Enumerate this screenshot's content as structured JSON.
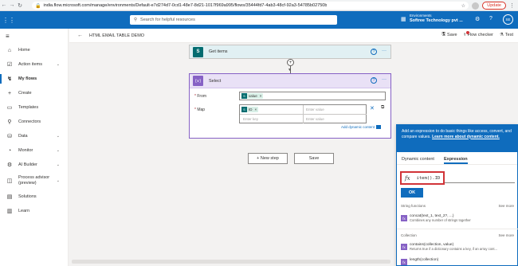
{
  "browser": {
    "url": "india.flow.microsoft.com/manage/environments/Default-e7d274d7-0cd1-48e7-8d21-1017f969a995/flows/35444fd7-4ab3-48cf-92a3-54785b02750b",
    "update_label": "Update"
  },
  "header": {
    "search_placeholder": "Search for helpful resources",
    "env_label": "Environments",
    "env_name": "Softree Technology pvt ...",
    "avatar_initials": "SE"
  },
  "sidebar": {
    "items": [
      {
        "label": "Home",
        "icon": "home-icon",
        "glyph": "⌂"
      },
      {
        "label": "Action items",
        "icon": "checklist-icon",
        "glyph": "☑",
        "chevron": true
      },
      {
        "label": "My flows",
        "icon": "flow-icon",
        "glyph": "↯",
        "active": true
      },
      {
        "label": "Create",
        "icon": "plus-icon",
        "glyph": "+"
      },
      {
        "label": "Templates",
        "icon": "template-icon",
        "glyph": "▭"
      },
      {
        "label": "Connectors",
        "icon": "connector-icon",
        "glyph": "⚲"
      },
      {
        "label": "Data",
        "icon": "database-icon",
        "glyph": "⛁",
        "chevron": true
      },
      {
        "label": "Monitor",
        "icon": "monitor-icon",
        "glyph": "◔",
        "chevron": true
      },
      {
        "label": "AI Builder",
        "icon": "ai-builder-icon",
        "glyph": "⚙",
        "chevron": true
      },
      {
        "label": "Process advisor (preview)",
        "icon": "process-advisor-icon",
        "glyph": "◫",
        "chevron": true
      },
      {
        "label": "Solutions",
        "icon": "solutions-icon",
        "glyph": "▤"
      },
      {
        "label": "Learn",
        "icon": "learn-icon",
        "glyph": "▥"
      }
    ]
  },
  "subheader": {
    "title": "HTML EMAIL TABLE DEMO",
    "save": "Save",
    "flow_checker": "Flow checker",
    "test": "Test"
  },
  "canvas": {
    "get_items_title": "Get items",
    "get_items_icon_text": "S",
    "select_title": "Select",
    "select_icon_text": "{∨}",
    "from_label": "From",
    "map_label": "Map",
    "from_token": "value",
    "map_token": "ID",
    "enter_key": "Enter key",
    "enter_value": "Enter value",
    "dynamic_content_link": "Add dynamic content",
    "new_step": "+ New step",
    "save": "Save"
  },
  "expression_panel": {
    "intro": "Add an expression to do basic things like access, convert, and compare values.",
    "learn_more": "Learn more about dynamic content.",
    "tab_dynamic": "Dynamic content",
    "tab_expression": "Expression",
    "fx_label": "fx",
    "expression_value": "item().ID",
    "ok_label": "OK",
    "section_string": "String functions",
    "see_more": "See more",
    "fn1_name": "concat(text_1, text_2?, ...)",
    "fn1_desc": "Combines any number of strings together",
    "section_collection": "Collection",
    "fn2_name": "contains(collection, value)",
    "fn2_desc": "Returns true if a dictionary contains a key, if an array cont...",
    "fn3_name": "length(collection)"
  }
}
